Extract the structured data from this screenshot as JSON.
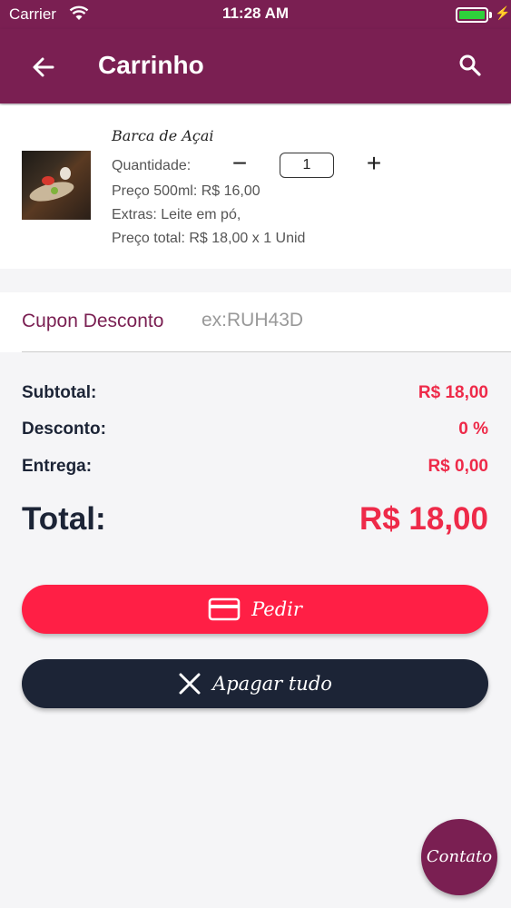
{
  "status_bar": {
    "carrier": "Carrier",
    "time": "11:28 AM"
  },
  "app_bar": {
    "title": "Carrinho",
    "back_icon": "arrow-left-icon",
    "search_icon": "search-icon"
  },
  "cart": {
    "items": [
      {
        "name": "Barca de Açai",
        "quantity_label": "Quantidade:",
        "quantity": "1",
        "price_line": "Preço 500ml:  R$ 16,00",
        "extras_line": "Extras: Leite em pó,",
        "total_line": "Preço total:  R$ 18,00 x 1 Unid"
      }
    ]
  },
  "coupon": {
    "label": "Cupon Desconto",
    "placeholder": "ex:RUH43D",
    "value": ""
  },
  "summary": {
    "subtotal_label": "Subtotal:",
    "subtotal_value": "R$ 18,00",
    "discount_label": "Desconto:",
    "discount_value": "0 %",
    "delivery_label": "Entrega:",
    "delivery_value": "R$ 0,00",
    "total_label": "Total:",
    "total_value": "R$ 18,00"
  },
  "actions": {
    "order_label": "Pedir",
    "clear_label": "Apagar tudo"
  },
  "fab": {
    "label": "Contato"
  },
  "colors": {
    "primary": "#7a1f52",
    "accent": "#ff1f45",
    "dark": "#1c2436",
    "price": "#ee2a49"
  }
}
